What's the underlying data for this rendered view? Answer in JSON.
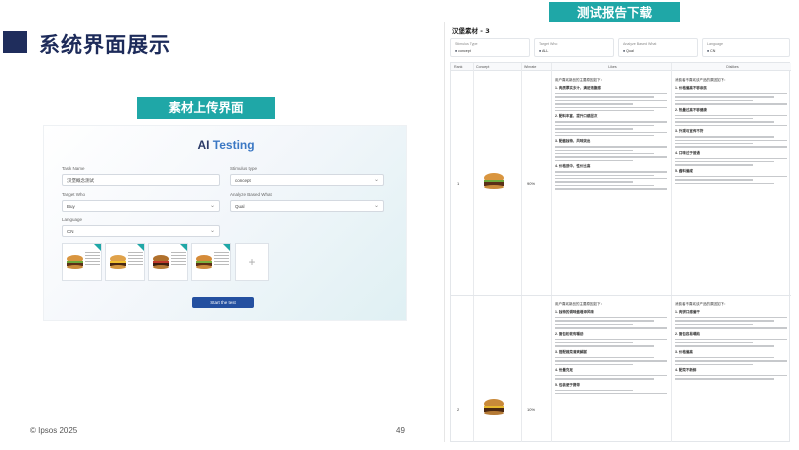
{
  "slide": {
    "title": "系统界面展示",
    "footer_copyright": "© Ipsos 2025",
    "page_number": "49",
    "upload_label": "素材上传界面",
    "download_label": "测试报告下载",
    "colors": {
      "navy": "#1d2b5a",
      "teal": "#1fa7a7",
      "button_blue": "#2450a0"
    }
  },
  "upload": {
    "app_title_prefix": "AI",
    "app_title_main": "Testing",
    "fields": {
      "task_name_label": "Task Name",
      "task_name_value": "汉堡概念测试",
      "stimulus_type_label": "Stimulus type",
      "stimulus_type_value": "concept",
      "target_who_label": "Target Who",
      "target_who_value": "Buy",
      "analyze_what_label": "Analyze Based What",
      "analyze_what_value": "Qual",
      "language_label": "Language",
      "language_value": "CN"
    },
    "thumbnail_count": 4,
    "add_icon": "plus-icon",
    "start_button": "Start the test"
  },
  "report": {
    "title": "汉堡素材 - 3",
    "filters": [
      {
        "key": "Stimulus Type",
        "value": "concept"
      },
      {
        "key": "Target Who",
        "value": "ALL"
      },
      {
        "key": "Analyze Based What",
        "value": "Qual"
      },
      {
        "key": "Language",
        "value": "CN"
      }
    ],
    "columns": [
      "Rank",
      "Concept",
      "Winrate",
      "Likes",
      "Dislikes"
    ],
    "rows": [
      {
        "rank": "1",
        "winrate": "90%",
        "likes_intro": "用户喜欢新品的主要原因如下：",
        "likes_points": [
          "1. 肉质厚实多汁，满足饱腹感",
          "2. 配料丰富，提升口感层次",
          "3. 配酱独特，风味突出",
          "4. 价格适中，性价比高"
        ],
        "dislikes_intro": "消费者不喜欢该产品的原因如下：",
        "dislikes_points": [
          "1. 价格偏高不够亲民",
          "2. 热量过高不够健康",
          "3. 外观与宣传不符",
          "4. 口味过于普通",
          "5. 酱料偏咸"
        ]
      },
      {
        "rank": "2",
        "winrate": "10%",
        "likes_intro": "用户喜欢新品的主要原因如下：",
        "likes_points": [
          "1. 独特的调味酱增添风味",
          "2. 面包松软有嚼劲",
          "3. 搭配蔬菜清爽解腻",
          "4. 份量充足",
          "5. 包装便于携带"
        ],
        "dislikes_intro": "消费者不喜欢该产品的原因如下：",
        "dislikes_points": [
          "1. 肉饼口感偏干",
          "2. 面包容易塌陷",
          "3. 价格偏高",
          "4. 配菜不新鲜"
        ]
      }
    ]
  }
}
